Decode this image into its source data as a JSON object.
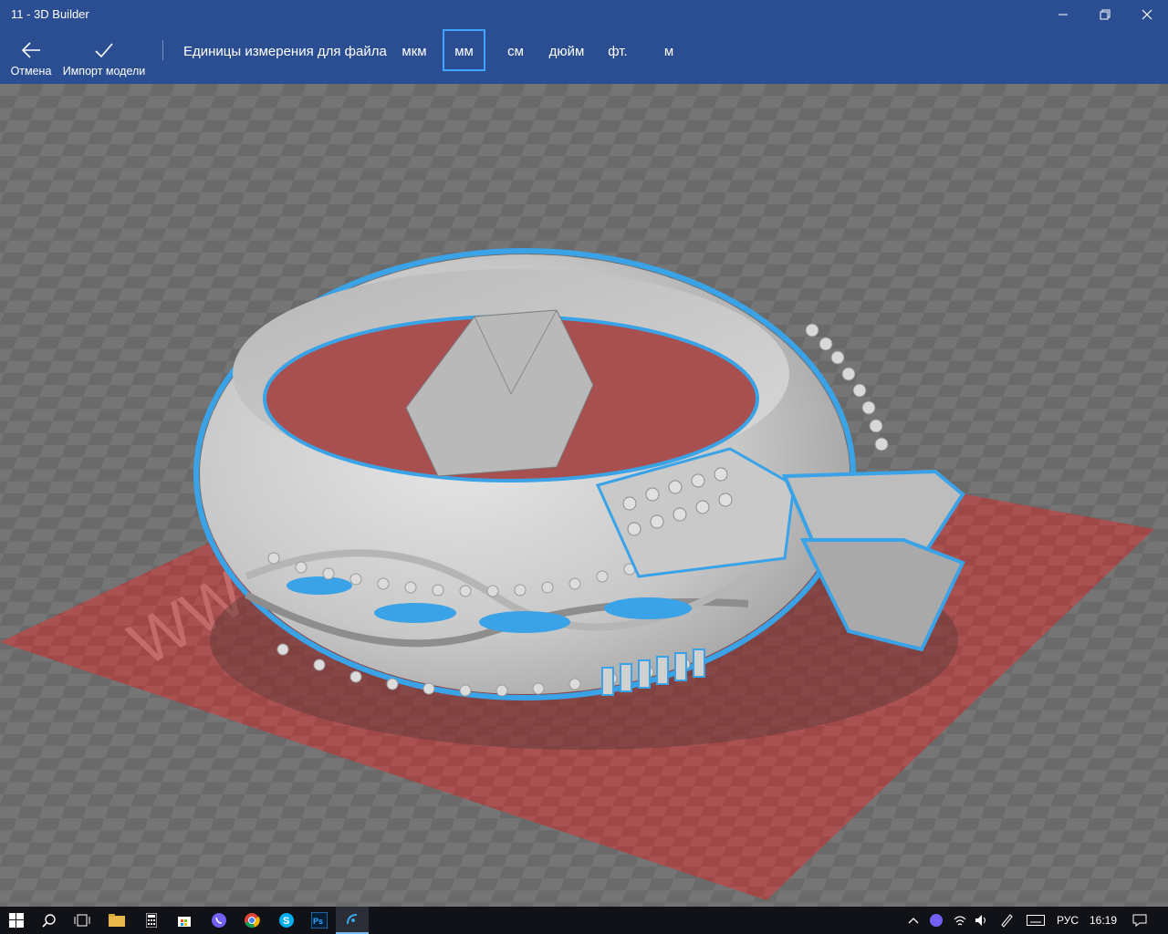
{
  "window": {
    "title": "11 - 3D Builder"
  },
  "toolbar": {
    "cancel_label": "Отмена",
    "import_label": "Импорт модели",
    "units_label": "Единицы измерения для файла",
    "units": [
      "мкм",
      "мм",
      "см",
      "дюйм",
      "фт.",
      "м"
    ],
    "selected_unit": "мм"
  },
  "viewport": {
    "model": "ring",
    "selection_color": "#3aa2e6",
    "plate_color": "#a94a4a"
  },
  "taskbar": {
    "language": "РУС",
    "time": "16:19"
  },
  "colors": {
    "accent": "#2b4e92",
    "highlight": "#3fa3ff"
  }
}
